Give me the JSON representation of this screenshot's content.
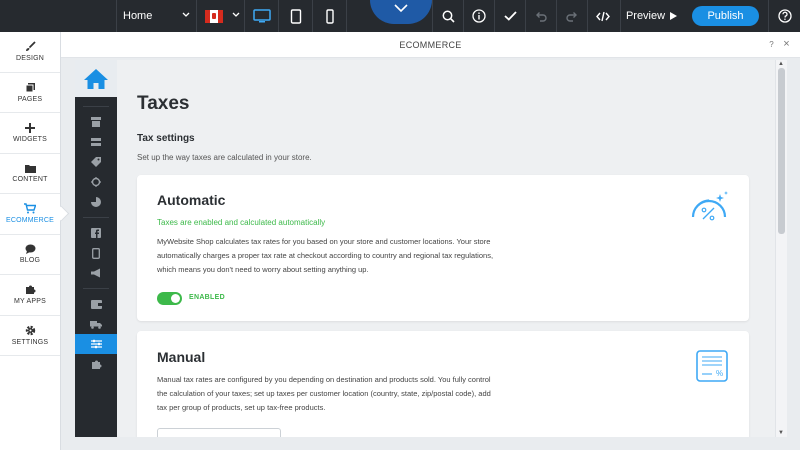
{
  "topbar": {
    "page_select": "Home",
    "preview_label": "Preview",
    "publish_label": "Publish"
  },
  "leftnav": {
    "items": [
      {
        "label": "DESIGN",
        "icon": "brush-icon"
      },
      {
        "label": "PAGES",
        "icon": "pages-icon"
      },
      {
        "label": "WIDGETS",
        "icon": "plus-icon"
      },
      {
        "label": "CONTENT",
        "icon": "folder-icon"
      },
      {
        "label": "ECOMMERCE",
        "icon": "cart-icon"
      },
      {
        "label": "BLOG",
        "icon": "chat-icon"
      },
      {
        "label": "MY APPS",
        "icon": "puzzle-icon"
      },
      {
        "label": "SETTINGS",
        "icon": "gear-icon"
      }
    ]
  },
  "panel": {
    "title": "ECOMMERCE",
    "help": "?",
    "close": "×"
  },
  "content": {
    "title": "Taxes",
    "section_title": "Tax settings",
    "section_desc": "Set up the way taxes are calculated in your store.",
    "auto": {
      "title": "Automatic",
      "status": "Taxes are enabled and calculated automatically",
      "body_1": "MyWebsite Shop calculates tax rates for you based on your store and customer locations. Your store",
      "body_2": "automatically charges a proper tax rate at checkout according to country and regional tax regulations,",
      "body_3": "which means you don't need to worry about setting anything up.",
      "toggle_label": "ENABLED",
      "enabled": true
    },
    "manual": {
      "title": "Manual",
      "body_1": "Manual tax rates are configured by you depending on destination and products sold. You fully control",
      "body_2": "the calculation of your taxes; set up taxes per customer location (country, state, zip/postal code), add",
      "body_3": "tax per group of products, set up tax-free products."
    }
  },
  "colors": {
    "accent": "#1a8fe3",
    "success": "#3db94a",
    "topbar": "#262a2f"
  }
}
